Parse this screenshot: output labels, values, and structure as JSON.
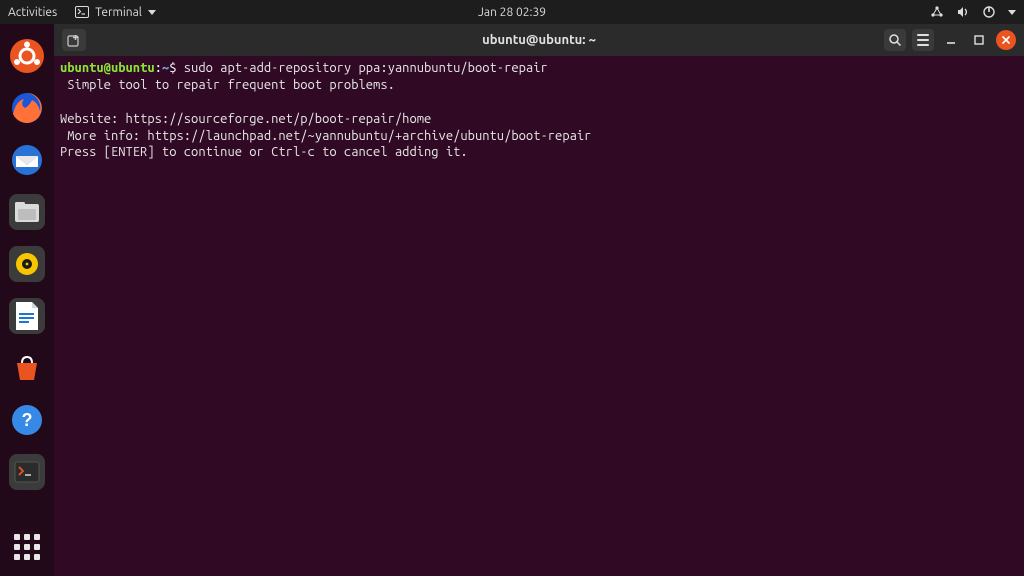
{
  "panel": {
    "activities": "Activities",
    "app_label": "Terminal",
    "clock": "Jan 28  02:39"
  },
  "dock": {
    "tooltip_writer": "LibreOffice Writer"
  },
  "window": {
    "title": "ubuntu@ubuntu: ~"
  },
  "terminal": {
    "prompt_user": "ubuntu@ubuntu",
    "prompt_colon": ":",
    "prompt_path": "~",
    "prompt_dollar": "$",
    "command": "sudo apt-add-repository ppa:yannubuntu/boot-repair",
    "line1": " Simple tool to repair frequent boot problems.",
    "line2": "",
    "line3": "Website: https://sourceforge.net/p/boot-repair/home",
    "line4": " More info: https://launchpad.net/~yannubuntu/+archive/ubuntu/boot-repair",
    "line5": "Press [ENTER] to continue or Ctrl-c to cancel adding it."
  }
}
